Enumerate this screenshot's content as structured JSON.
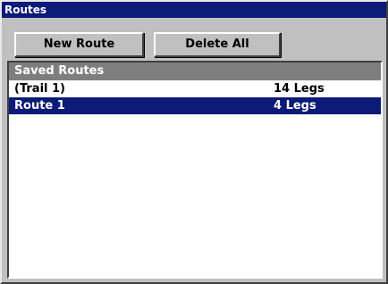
{
  "window": {
    "title": "Routes"
  },
  "toolbar": {
    "new_route_label": "New Route",
    "delete_all_label": "Delete All"
  },
  "saved_routes": {
    "header": "Saved Routes",
    "items": [
      {
        "name": "(Trail 1)",
        "legs": "14 Legs",
        "selected": false
      },
      {
        "name": "Route 1",
        "legs": "4 Legs",
        "selected": true
      }
    ]
  },
  "colors": {
    "titlebar": "#0c1a78",
    "selection": "#0c1a78",
    "header": "#7e7e7e",
    "window_face": "#c0c0c0"
  }
}
